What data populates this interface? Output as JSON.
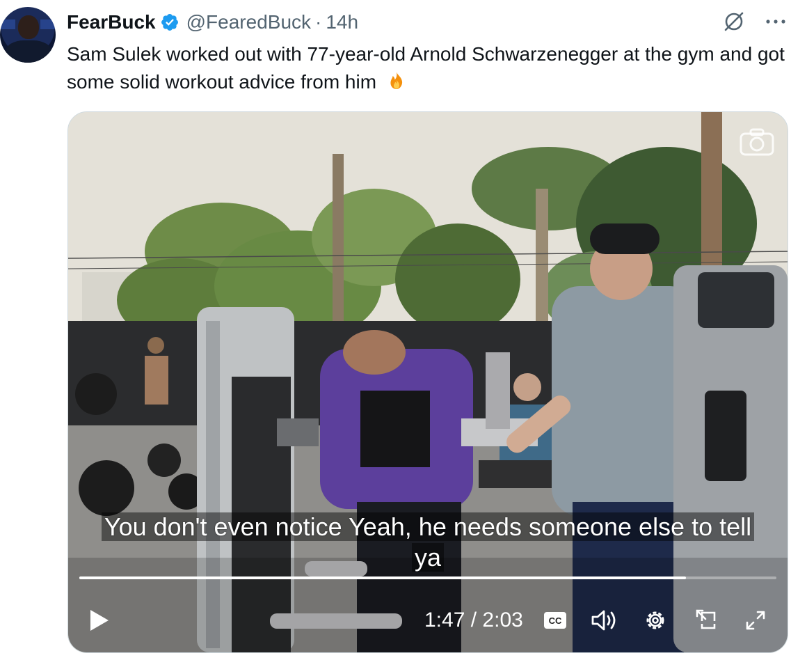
{
  "author": {
    "display_name": "FearBuck",
    "handle": "@FearedBuck",
    "separator": "·",
    "time_ago": "14h",
    "verified": true
  },
  "tweet": {
    "text": "Sam Sulek worked out with 77-year-old Arnold Schwarzenegger at the gym and got some solid workout advice from him",
    "emoji_icon": "fire-emoji"
  },
  "header_icons": [
    "grok-icon",
    "more-icon"
  ],
  "video": {
    "caption_line1": "You don't even notice Yeah, he needs someone else to tell",
    "caption_line2": "ya",
    "current_time": "1:47",
    "time_separator": "/",
    "duration": "2:03",
    "progress_fraction": 0.87,
    "cc_label": "CC",
    "controls": [
      "play-icon",
      "cc-icon",
      "volume-icon",
      "settings-icon",
      "pip-icon",
      "fullscreen-icon",
      "camera-icon"
    ]
  },
  "colors": {
    "accent_verified": "#1d9bf0",
    "muted_text": "#536471",
    "text": "#0f1419"
  }
}
